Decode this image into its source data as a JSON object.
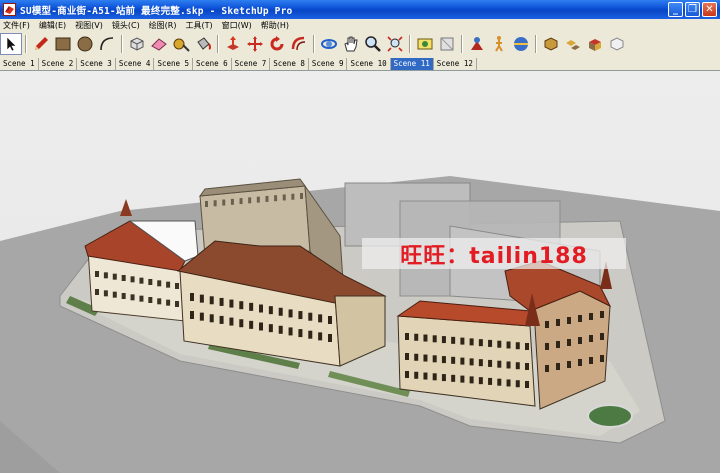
{
  "window": {
    "title": "SU模型-商业街-A51-站前  最终完整.skp - SketchUp Pro",
    "minimize_label": "_",
    "restore_label": "❐",
    "close_label": "✕"
  },
  "menu": [
    "文件(F)",
    "编辑(E)",
    "视图(V)",
    "镜头(C)",
    "绘图(R)",
    "工具(T)",
    "窗口(W)",
    "帮助(H)"
  ],
  "toolbar": {
    "tools": [
      {
        "name": "select-tool",
        "icon": "arrow-cursor-icon",
        "active": true
      },
      {
        "name": "pencil-tool",
        "icon": "pencil-icon"
      },
      {
        "name": "rectangle-tool",
        "icon": "rectangle-icon"
      },
      {
        "name": "circle-tool",
        "icon": "circle-icon"
      },
      {
        "name": "arc-tool",
        "icon": "arc-icon"
      },
      {
        "name": "make-component-tool",
        "icon": "component-icon"
      },
      {
        "name": "eraser-tool",
        "icon": "eraser-icon"
      },
      {
        "name": "tape-measure-tool",
        "icon": "tape-measure-icon"
      },
      {
        "name": "paint-bucket-tool",
        "icon": "paint-bucket-icon"
      },
      {
        "name": "push-pull-tool",
        "icon": "push-pull-icon"
      },
      {
        "name": "move-tool",
        "icon": "move-arrows-icon"
      },
      {
        "name": "rotate-tool",
        "icon": "rotate-icon"
      },
      {
        "name": "offset-tool",
        "icon": "offset-icon"
      },
      {
        "name": "orbit-tool",
        "icon": "orbit-icon"
      },
      {
        "name": "pan-tool",
        "icon": "hand-icon"
      },
      {
        "name": "zoom-tool",
        "icon": "magnifier-icon"
      },
      {
        "name": "zoom-extents-tool",
        "icon": "zoom-extents-icon"
      },
      {
        "name": "google-earth-tool",
        "icon": "google-earth-icon"
      },
      {
        "name": "get-models-tool",
        "icon": "3d-warehouse-icon"
      },
      {
        "name": "position-camera-tool",
        "icon": "position-camera-icon"
      },
      {
        "name": "walk-tool",
        "icon": "walk-icon"
      },
      {
        "name": "look-around-tool",
        "icon": "look-around-icon"
      },
      {
        "name": "section-plane-tool",
        "icon": "section-plane-icon"
      },
      {
        "name": "components-browser-tool",
        "icon": "components-icon"
      },
      {
        "name": "materials-browser-tool",
        "icon": "materials-icon"
      },
      {
        "name": "share-model-tool",
        "icon": "share-model-icon"
      }
    ]
  },
  "scenes": {
    "tabs": [
      "Scene 1",
      "Scene 2",
      "Scene 3",
      "Scene 4",
      "Scene 5",
      "Scene 6",
      "Scene 7",
      "Scene 8",
      "Scene 9",
      "Scene 10",
      "Scene 11",
      "Scene 12"
    ],
    "active_index": 10
  },
  "watermark": {
    "text": "旺旺：tailin188"
  },
  "colors": {
    "title_bar": "#0a4fd6",
    "chrome": "#ece9d8",
    "active_tab": "#316ac5",
    "sky": "#ededed",
    "roof": "#b84a2c",
    "watermark_text": "#e31b23"
  }
}
